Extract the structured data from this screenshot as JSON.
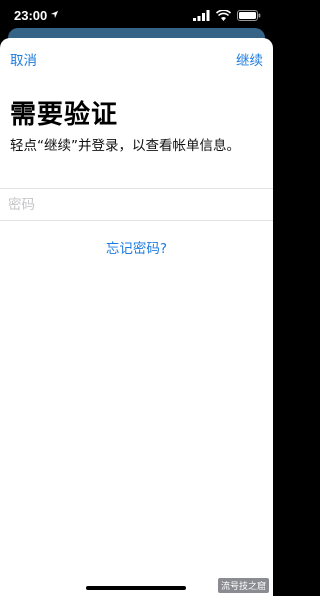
{
  "status_bar": {
    "time": "23:00",
    "icons": [
      "location-arrow-icon",
      "signal-bars-icon",
      "wifi-icon",
      "battery-icon"
    ]
  },
  "nav": {
    "cancel_label": "取消",
    "continue_label": "继续"
  },
  "content": {
    "title": "需要验证",
    "description": "轻点“继续”并登录，以查看帐单信息。"
  },
  "password": {
    "placeholder": "密码",
    "value": ""
  },
  "forgot_password_label": "忘记密码?",
  "watermark": "流号技之窟",
  "colors": {
    "accent": "#1e7ce0",
    "background": "#000000",
    "sheet": "#ffffff"
  }
}
